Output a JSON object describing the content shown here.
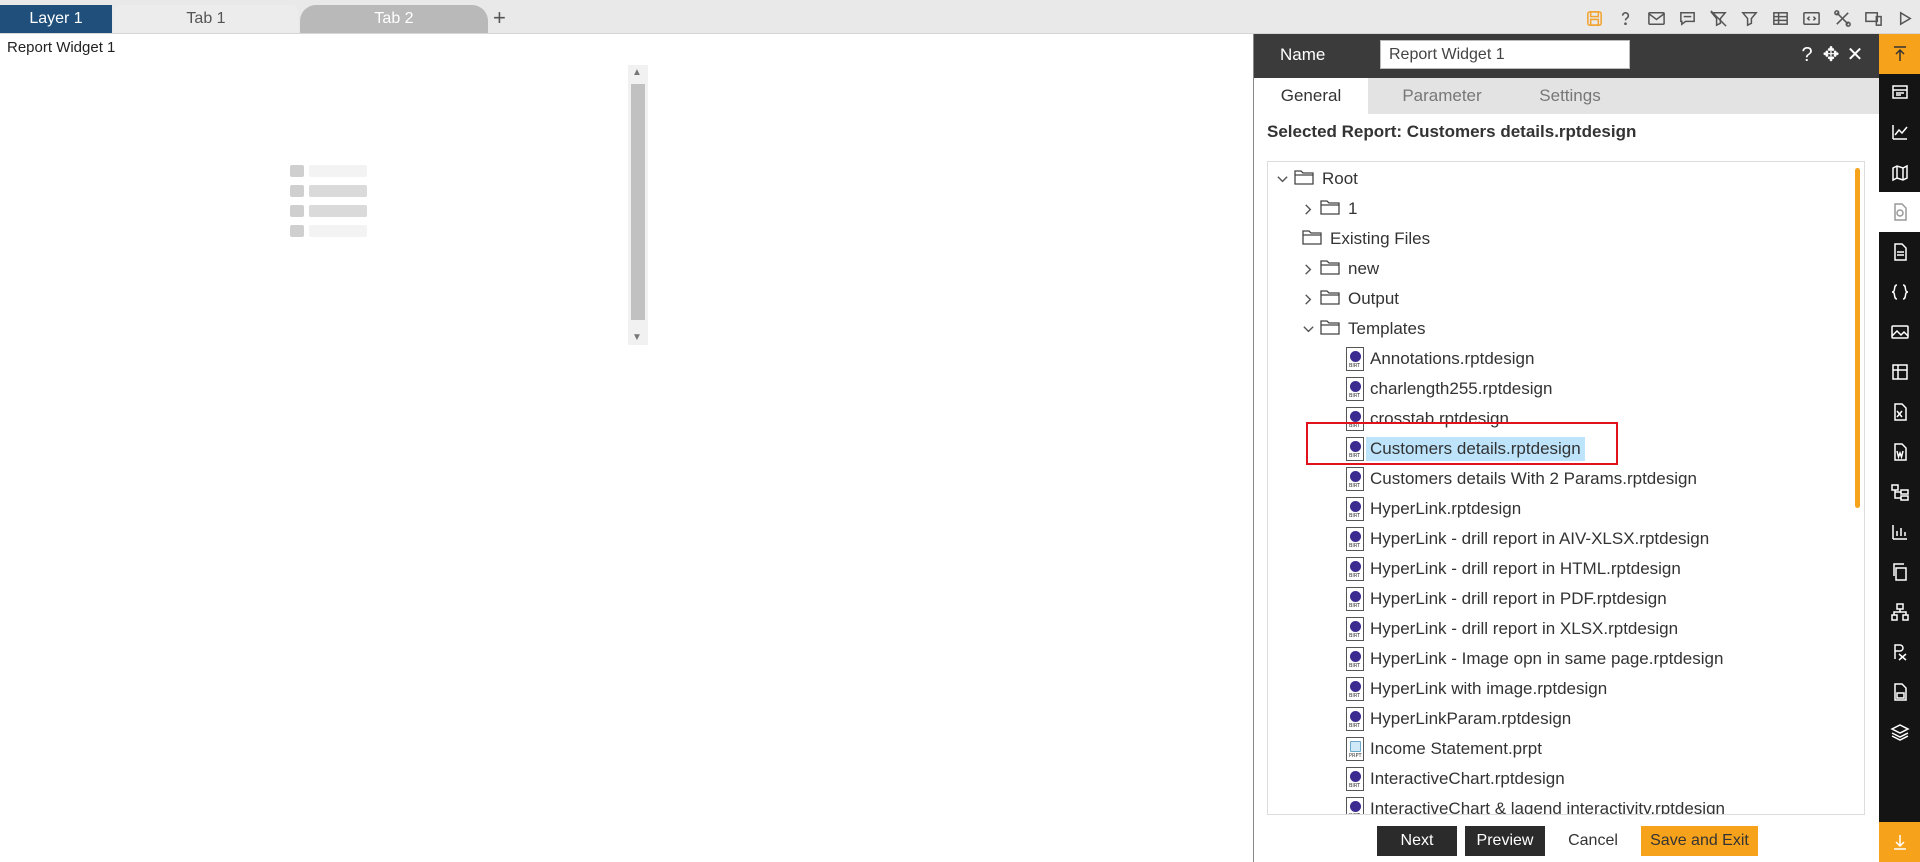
{
  "tabs": {
    "layer": "Layer 1",
    "tab1": "Tab 1",
    "tab2": "Tab 2",
    "add": "+"
  },
  "toolbar_icons": [
    "save-icon",
    "help-icon",
    "mail-icon",
    "comment-icon",
    "clear-filter-icon",
    "filter-icon",
    "table-icon",
    "embed-icon",
    "tools-icon",
    "devices-icon",
    "play-icon"
  ],
  "canvas": {
    "widget_label": "Report Widget 1"
  },
  "panel": {
    "name_label": "Name",
    "name_value": "Report Widget 1",
    "tabs": [
      "General",
      "Parameter",
      "Settings"
    ],
    "selected_report": "Selected Report: Customers details.rptdesign",
    "tree": [
      {
        "label": "Root",
        "type": "folder",
        "expanded": true,
        "level": 0
      },
      {
        "label": "1",
        "type": "folder",
        "expanded": false,
        "level": 1
      },
      {
        "label": "Existing Files",
        "type": "folder",
        "level": 1,
        "no_chevron": true
      },
      {
        "label": "new",
        "type": "folder",
        "expanded": false,
        "level": 2
      },
      {
        "label": "Output",
        "type": "folder",
        "expanded": false,
        "level": 2
      },
      {
        "label": "Templates",
        "type": "folder",
        "expanded": true,
        "level": 2
      },
      {
        "label": "Annotations.rptdesign",
        "type": "file",
        "level": 3
      },
      {
        "label": "charlength255.rptdesign",
        "type": "file",
        "level": 3
      },
      {
        "label": "crosstab.rptdesign",
        "type": "file",
        "level": 3
      },
      {
        "label": "Customers details.rptdesign",
        "type": "file",
        "level": 3,
        "selected": true
      },
      {
        "label": "Customers details With 2 Params.rptdesign",
        "type": "file",
        "level": 3
      },
      {
        "label": "HyperLink.rptdesign",
        "type": "file",
        "level": 3
      },
      {
        "label": "HyperLink - drill report in AIV-XLSX.rptdesign",
        "type": "file",
        "level": 3
      },
      {
        "label": "HyperLink - drill report in HTML.rptdesign",
        "type": "file",
        "level": 3
      },
      {
        "label": "HyperLink - drill report in PDF.rptdesign",
        "type": "file",
        "level": 3
      },
      {
        "label": "HyperLink - drill report in XLSX.rptdesign",
        "type": "file",
        "level": 3
      },
      {
        "label": "HyperLink - Image opn in same page.rptdesign",
        "type": "file",
        "level": 3
      },
      {
        "label": "HyperLink with image.rptdesign",
        "type": "file",
        "level": 3
      },
      {
        "label": "HyperLinkParam.rptdesign",
        "type": "file",
        "level": 3
      },
      {
        "label": "Income Statement.prpt",
        "type": "prpt",
        "level": 3
      },
      {
        "label": "InteractiveChart.rptdesign",
        "type": "file",
        "level": 3
      },
      {
        "label": "InteractiveChart & lagend interactivity.rptdesign",
        "type": "file",
        "level": 3
      }
    ],
    "file_tag": "BIRT",
    "prpt_tag": "PRPT",
    "buttons": {
      "next": "Next",
      "preview": "Preview",
      "cancel": "Cancel",
      "save": "Save and Exit"
    }
  },
  "side_icons": [
    "scroll-top-icon",
    "widget-icon",
    "chart-icon",
    "map-icon",
    "report-widget-icon",
    "document-icon",
    "code-icon",
    "image-icon",
    "grid-icon",
    "excel-icon",
    "word-icon",
    "tree-map-icon",
    "bar-chart-icon",
    "copy-icon",
    "hierarchy-icon",
    "formula-icon",
    "save-file-icon",
    "layers-icon",
    "download-icon"
  ],
  "colors": {
    "accent": "#f7a21b",
    "layer_tab": "#1f4f7a",
    "panel_header": "#3b3b3b",
    "selection": "#bde4fb",
    "highlight_border": "#e0121b"
  }
}
